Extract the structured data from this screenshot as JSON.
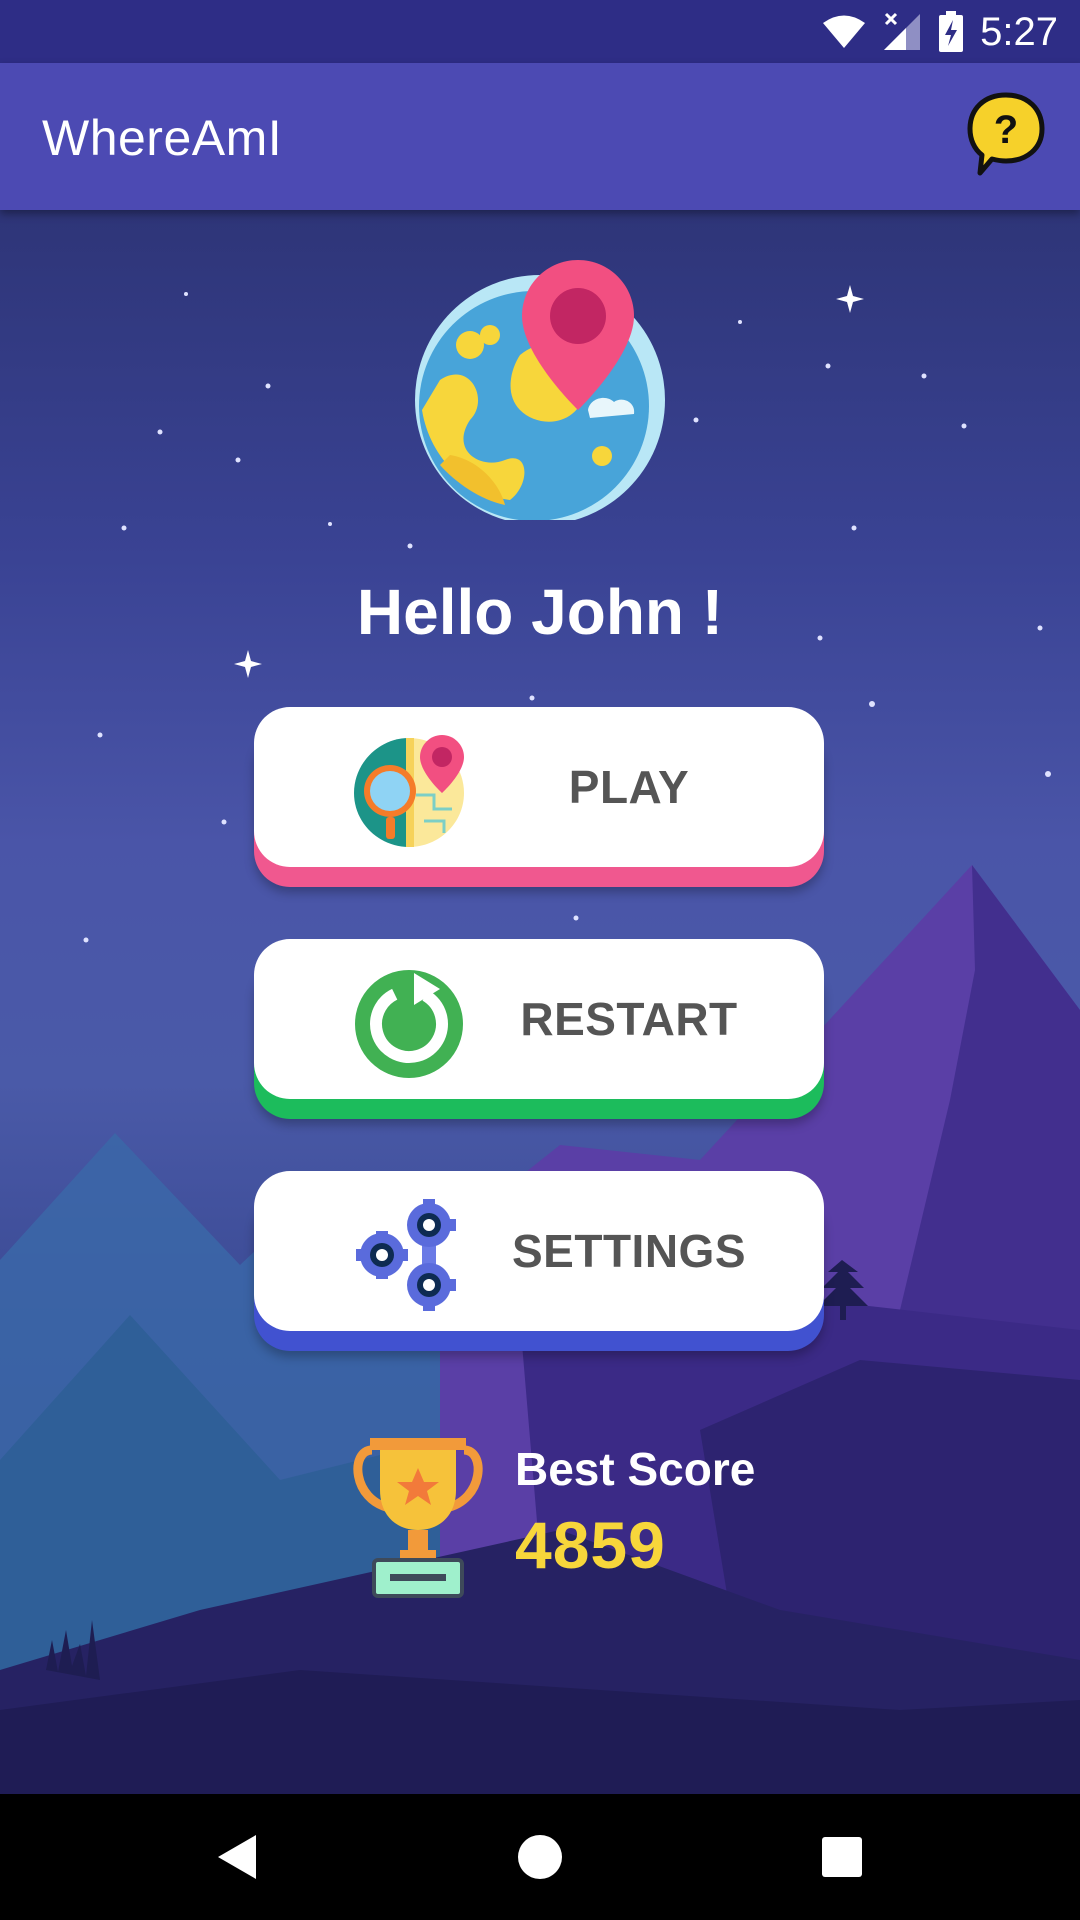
{
  "status_bar": {
    "time": "5:27",
    "icons": [
      "wifi-icon",
      "cell-signal-icon",
      "battery-charging-icon"
    ]
  },
  "app_bar": {
    "title": "WhereAmI",
    "help_icon": "help-bubble-icon"
  },
  "greeting": "Hello John !",
  "menu": {
    "play": {
      "label": "PLAY",
      "icon": "map-search-icon",
      "accent": "#f0588f"
    },
    "restart": {
      "label": "RESTART",
      "icon": "restart-icon",
      "accent": "#1cbc5c"
    },
    "settings": {
      "label": "SETTINGS",
      "icon": "gears-icon",
      "accent": "#4152d0"
    }
  },
  "best_score": {
    "label": "Best Score",
    "value": "4859",
    "icon": "trophy-icon"
  },
  "nav_bar": {
    "buttons": [
      "back-icon",
      "home-icon",
      "recents-icon"
    ]
  },
  "colors": {
    "app_bar": "#4c4ab3",
    "status_bar": "#2e2d86",
    "score": "#f7d63b"
  }
}
